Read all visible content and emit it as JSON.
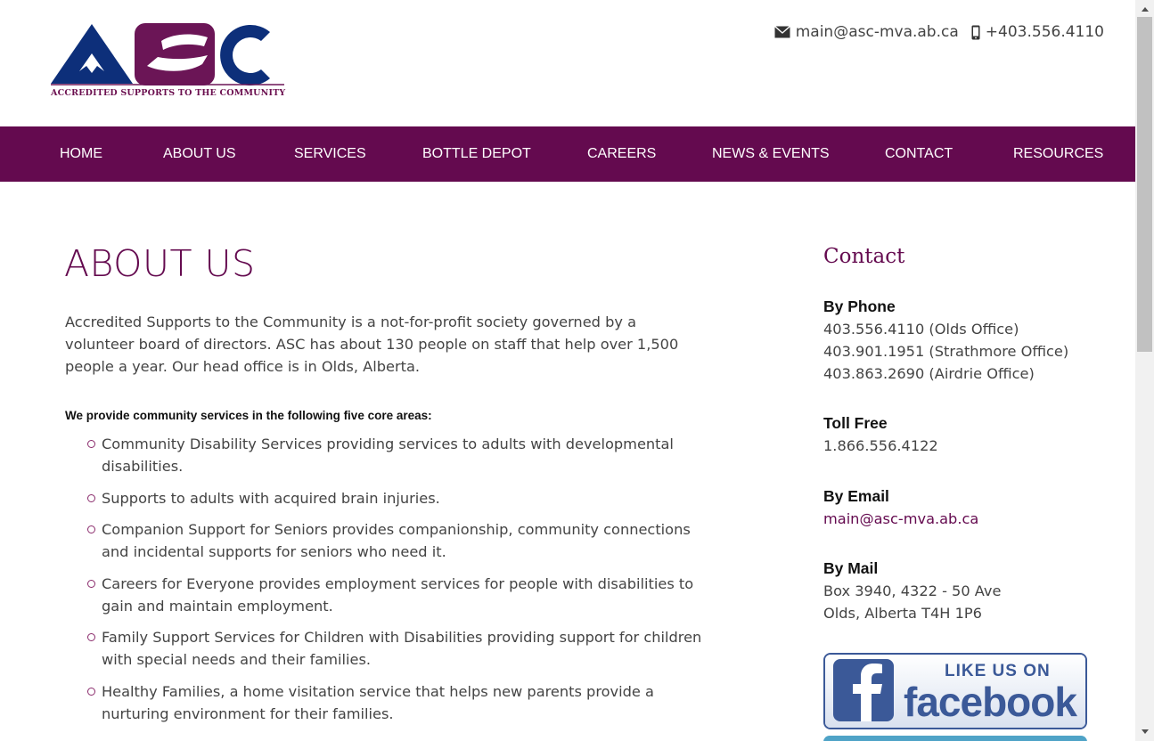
{
  "header": {
    "logo_caption": "ACCREDITED SUPPORTS TO THE COMMUNITY",
    "email": "main@asc-mva.ab.ca",
    "phone": "+403.556.4110",
    "email_icon": "envelope-icon",
    "phone_icon": "mobile-phone-icon"
  },
  "nav": {
    "items": [
      {
        "label": "HOME"
      },
      {
        "label": "ABOUT US"
      },
      {
        "label": "SERVICES"
      },
      {
        "label": "BOTTLE DEPOT"
      },
      {
        "label": "CAREERS"
      },
      {
        "label": "NEWS & EVENTS"
      },
      {
        "label": "CONTACT"
      },
      {
        "label": "RESOURCES"
      }
    ]
  },
  "main": {
    "title": "ABOUT US",
    "intro": "Accredited Supports to the Community is a not-for-profit society governed by a volunteer board of directors.  ASC has about 130 people on staff that help over 1,500 people a year.  Our head office is in Olds, Alberta.",
    "core_heading": "We provide community services in the following five core areas:",
    "areas": [
      "Community Disability Services providing services to adults with developmental disabilities.",
      "Supports to adults with acquired brain injuries.",
      "Companion Support for Seniors provides companionship, community connections and incidental supports for seniors who need it.",
      "Careers for Everyone provides employment services for people with disabilities to gain and maintain employment.",
      "Family Support Services for Children with Disabilities providing support for children with special needs and their families.",
      "Healthy Families, a home visitation service that helps new parents provide a nurturing environment for their families."
    ]
  },
  "sidebar": {
    "title": "Contact",
    "phone_heading": "By Phone",
    "phones": [
      "403.556.4110 (Olds Office)",
      "403.901.1951 (Strathmore Office)",
      "403.863.2690 (Airdrie Office)"
    ],
    "tollfree_heading": "Toll Free",
    "tollfree": "1.866.556.4122",
    "email_heading": "By Email",
    "email": "main@asc-mva.ab.ca",
    "mail_heading": "By Mail",
    "mail_lines": [
      "Box 3940, 4322 - 50 Ave",
      "Olds, Alberta T4H 1P6"
    ],
    "facebook": {
      "top_text": "LIKE US ON",
      "brand_text": "facebook"
    }
  },
  "colors": {
    "brand": "#640a4f",
    "navy": "#0d2f7a",
    "facebook": "#3b5998"
  }
}
